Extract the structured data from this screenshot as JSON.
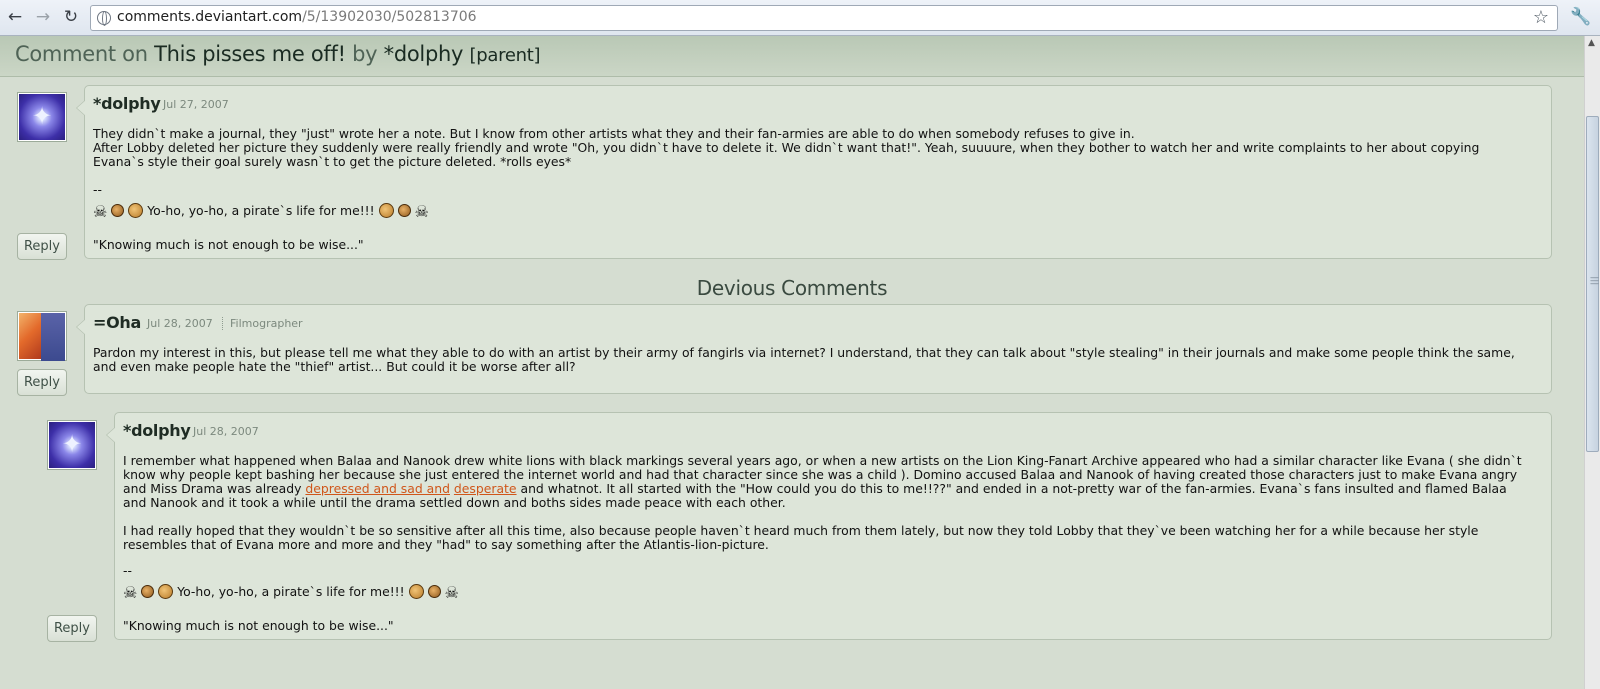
{
  "browser": {
    "back_icon": "arrow-left-icon",
    "forward_icon": "arrow-right-icon",
    "reload_icon": "reload-icon",
    "url_host": "comments.deviantart.com",
    "url_path": "/5/13902030/502813706",
    "bookmark_icon": "star-icon",
    "menu_icon": "wrench-icon"
  },
  "header": {
    "prefix": "Comment on",
    "title": "This pisses me off!",
    "by": "by",
    "author": "*dolphy",
    "parent_link": "[parent]"
  },
  "section_heading": "Devious Comments",
  "comments": [
    {
      "username": "*dolphy",
      "date": "Jul 27, 2007",
      "body": [
        "They didn`t make a journal, they \"just\" wrote her a note. But I know from other artists what they and their fan-armies are able to do when somebody refuses to give in.",
        "After Lobby deleted her picture they suddenly were really friendly and wrote \"Oh, you didn`t have to delete it. We didn`t want that!\". Yeah, suuuure, when they bother to watch her and write complaints to her about copying Evana`s style their goal surely wasn`t to get the picture deleted. *rolls eyes*"
      ],
      "sig_dashes": "--",
      "sig_text": "Yo-ho, yo-ho, a pirate`s life for me!!!",
      "sig_quote": "\"Knowing much is not enough to be wise...\"",
      "reply": "Reply"
    },
    {
      "username": "=Oha",
      "date": "Jul 28, 2007",
      "user_title": "Filmographer",
      "body": [
        "Pardon my interest in this, but please tell me what they able to do with an artist by their army of fangirls via internet? I understand, that they can talk about \"style stealing\" in their journals and make some people think the same, and even make people hate the \"thief\" artist... But could it be worse after all?"
      ],
      "reply": "Reply"
    },
    {
      "username": "*dolphy",
      "date": "Jul 28, 2007",
      "body_a": "I remember what happened when Balaa and Nanook drew white lions with black markings several years ago, or when a new artists on the Lion King-Fanart Archive appeared who had a similar character like Evana ( she didn`t know why people kept bashing her because she just entered the internet world and had that character since she was a child ). Domino accused Balaa and Nanook of having created those characters just to make Evana angry and Miss Drama was already ",
      "link_1": "depressed and sad and",
      "link_2": "desperate",
      "body_b": " and whatnot. It all started with the \"How could you do this to me!!??\" and ended in a not-pretty war of the fan-armies. Evana`s fans insulted and flamed Balaa and Nanook and it took a while until the drama settled down and boths sides made peace with each other.",
      "body_c": "I had really hoped that they wouldn`t be so sensitive after all this time, also because people haven`t heard much from them lately, but now they told Lobby that they`ve been watching her for a while because her style resembles that of Evana more and more and they \"had\" to say something after the Atlantis-lion-picture.",
      "sig_dashes": "--",
      "sig_text": "Yo-ho, yo-ho, a pirate`s life for me!!!",
      "sig_quote": "\"Knowing much is not enough to be wise...\"",
      "reply": "Reply"
    }
  ],
  "emoticons": [
    "skull-crossbones-icon",
    "pirate-face-icon",
    "parrot-face-icon"
  ]
}
